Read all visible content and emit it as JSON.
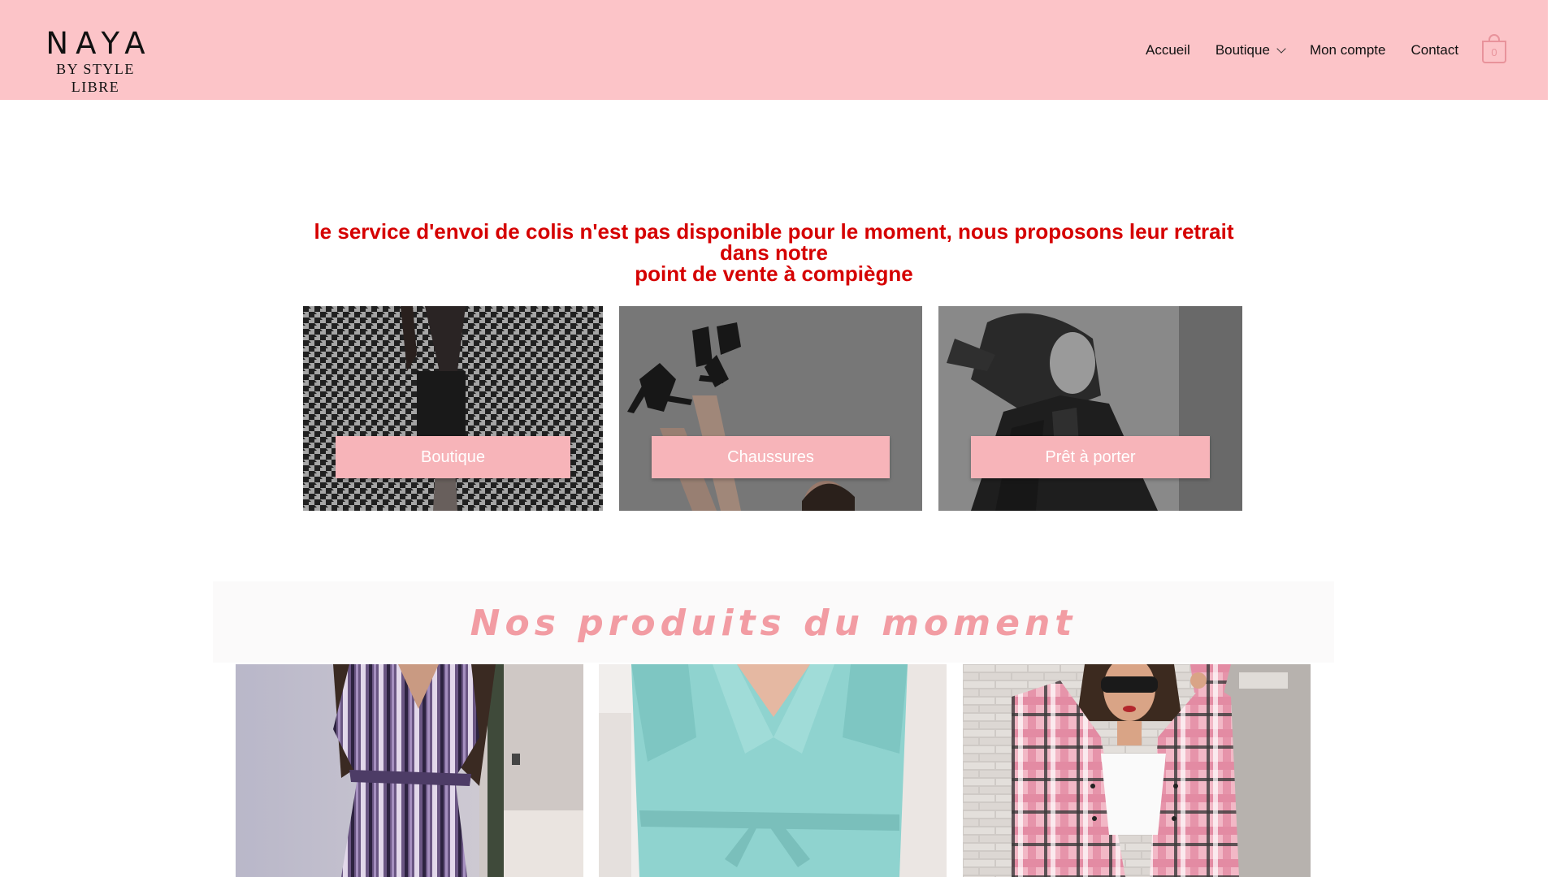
{
  "header": {
    "logo_main": "NAYA",
    "logo_sub": "BY STYLE LIBRE",
    "nav": [
      {
        "label": "Accueil"
      },
      {
        "label": "Boutique",
        "has_dropdown": true
      },
      {
        "label": "Mon compte"
      },
      {
        "label": "Contact"
      }
    ],
    "cart_count": "0",
    "bg_color": "#fcc4c8"
  },
  "notice": {
    "line1": "le service d'envoi de colis n'est pas disponible pour le moment, nous proposons leur retrait dans notre",
    "line2": "point de vente à compiègne",
    "color": "#d50000"
  },
  "categories": [
    {
      "label": "Boutique",
      "image": "houndstooth-jacket-photo"
    },
    {
      "label": "Chaussures",
      "image": "black-heels-photo"
    },
    {
      "label": "Prêt à porter",
      "image": "leather-jacket-photo"
    }
  ],
  "products_section": {
    "title": "Nos produits du moment",
    "title_color": "#f29ca3",
    "products": [
      {
        "image": "purple-print-dress-photo"
      },
      {
        "image": "mint-wrap-coat-photo"
      },
      {
        "image": "pink-plaid-shirt-photo"
      }
    ]
  },
  "colors": {
    "button_bg": "#f7b4b9",
    "cart_accent": "#e8939b"
  }
}
